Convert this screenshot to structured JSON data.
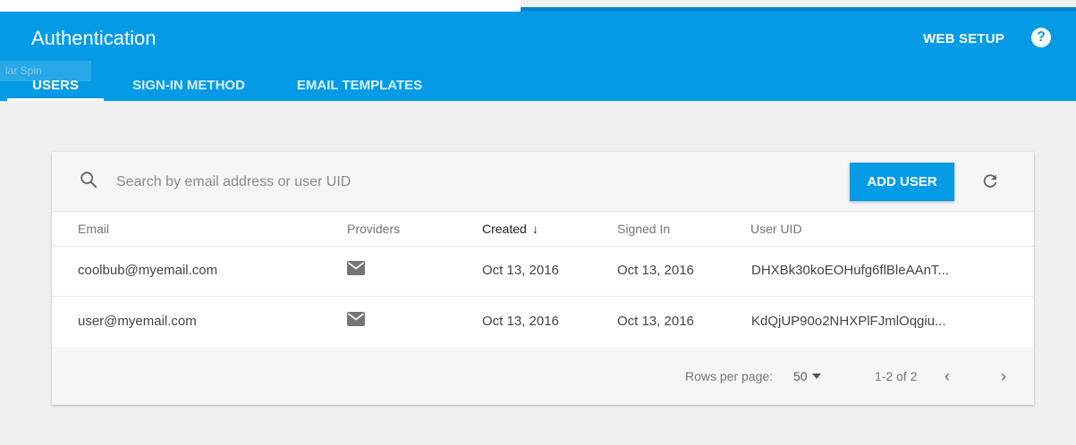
{
  "header": {
    "title": "Authentication",
    "web_setup": "WEB SETUP",
    "help": "?",
    "ghost_text": "lar Spin"
  },
  "tabs": [
    {
      "label": "USERS",
      "active": true
    },
    {
      "label": "SIGN-IN METHOD",
      "active": false
    },
    {
      "label": "EMAIL TEMPLATES",
      "active": false
    }
  ],
  "toolbar": {
    "search_placeholder": "Search by email address or user UID",
    "add_user": "ADD USER"
  },
  "table": {
    "columns": [
      "Email",
      "Providers",
      "Created",
      "Signed In",
      "User UID"
    ],
    "sorted_column": "Created",
    "sort_arrow": "↓",
    "rows": [
      {
        "email": "coolbub@myemail.com",
        "provider_icon": "mail-icon",
        "created": "Oct 13, 2016",
        "signed_in": "Oct 13, 2016",
        "uid": "DHXBk30koEOHufg6flBleAAnT..."
      },
      {
        "email": "user@myemail.com",
        "provider_icon": "mail-icon",
        "created": "Oct 13, 2016",
        "signed_in": "Oct 13, 2016",
        "uid": "KdQjUP90o2NHXPlFJmlOqgiu..."
      }
    ]
  },
  "footer": {
    "rows_per_page_label": "Rows per page:",
    "rows_per_page_value": "50",
    "range": "1-2 of 2",
    "prev": "‹",
    "next": "›"
  },
  "colors": {
    "accent": "#039be5",
    "background": "#f0f0f0"
  }
}
